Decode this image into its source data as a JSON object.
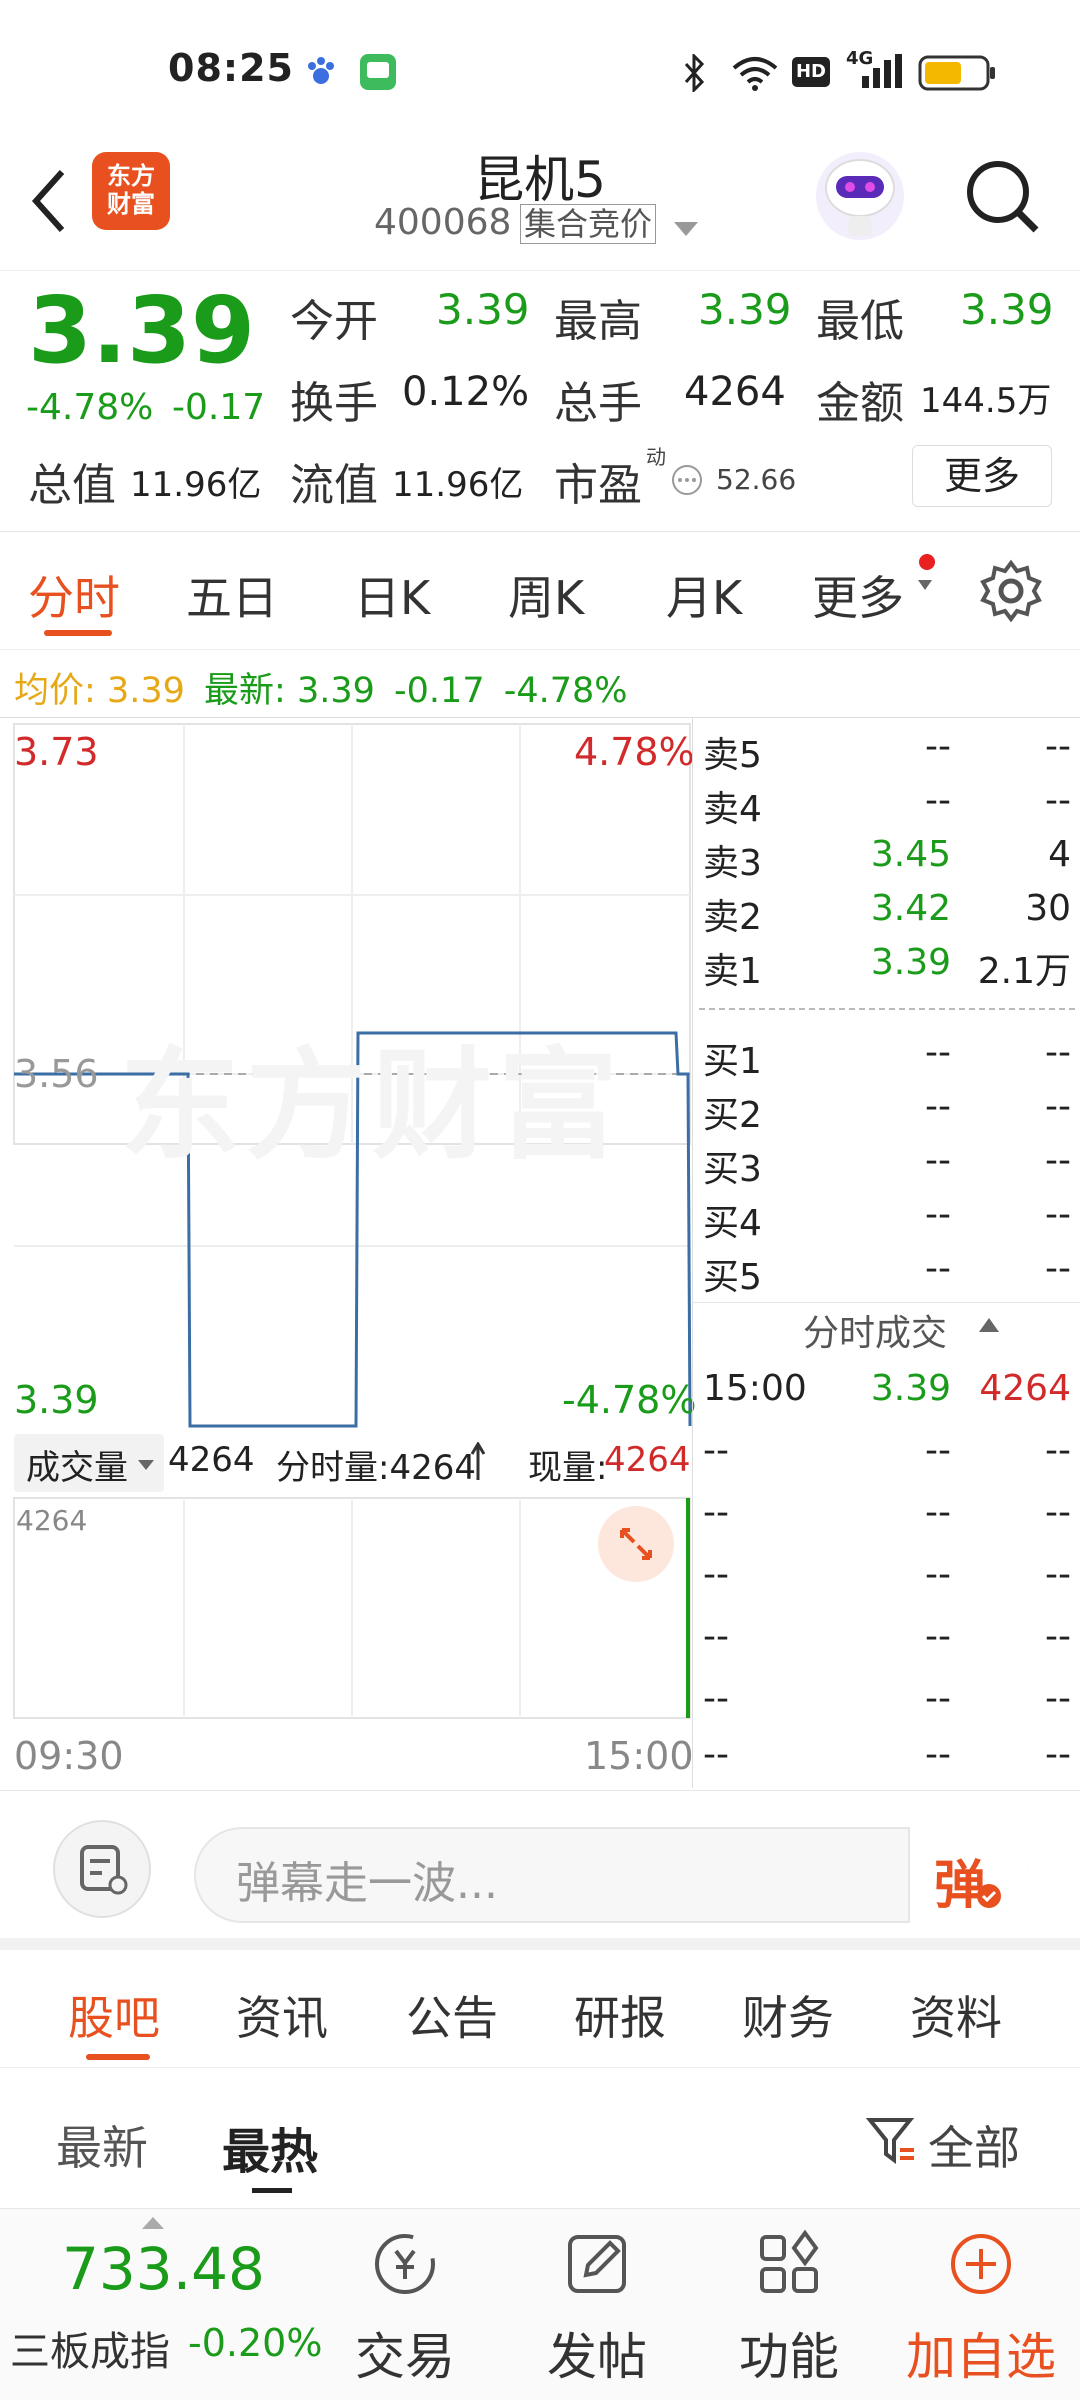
{
  "status_bar": {
    "time": "08:25",
    "network": "4G",
    "hd": "HD"
  },
  "header": {
    "title": "昆机5",
    "code": "400068",
    "auction_tag": "集合竞价",
    "logo_line1": "东方",
    "logo_line2": "财富"
  },
  "quote": {
    "price": "3.39",
    "change_pct": "-4.78%",
    "change": "-0.17",
    "fields": {
      "open_label": "今开",
      "open": "3.39",
      "high_label": "最高",
      "high": "3.39",
      "low_label": "最低",
      "low": "3.39",
      "turnover_label": "换手",
      "turnover": "0.12%",
      "volume_label": "总手",
      "volume": "4264",
      "amount_label": "金额",
      "amount": "144.5万",
      "mktcap_label": "总值",
      "mktcap": "11.96亿",
      "float_label": "流值",
      "float": "11.96亿",
      "pe_label": "市盈",
      "pe_sup": "动",
      "pe": "52.66"
    },
    "more_button": "更多"
  },
  "tabs": [
    "分时",
    "五日",
    "日K",
    "周K",
    "月K",
    "更多"
  ],
  "avg_line": {
    "avg_label": "均价:",
    "avg": "3.39",
    "latest_label": "最新:",
    "latest": "3.39",
    "chg": "-0.17",
    "pct": "-4.78%"
  },
  "chart": {
    "y_top": "3.73",
    "y_mid": "3.56",
    "y_bottom": "3.39",
    "pct_top": "4.78%",
    "pct_bottom": "-4.78%",
    "watermark": "东方财富",
    "vol_label": "成交量",
    "vol_total": "4264",
    "fenshi_label": "分时量:4264",
    "xian_label": "现量:",
    "xian_value": "4264",
    "vol_max": "4264",
    "time_start": "09:30",
    "time_end": "15:00",
    "colors": {
      "line": "#3a6ea5",
      "up": "#d22a2a",
      "down": "#1a9b1a"
    }
  },
  "orderbook": {
    "asks": [
      {
        "name": "卖5",
        "price": "--",
        "qty": "--"
      },
      {
        "name": "卖4",
        "price": "--",
        "qty": "--"
      },
      {
        "name": "卖3",
        "price": "3.45",
        "qty": "4"
      },
      {
        "name": "卖2",
        "price": "3.42",
        "qty": "30"
      },
      {
        "name": "卖1",
        "price": "3.39",
        "qty": "2.1万"
      }
    ],
    "bids": [
      {
        "name": "买1",
        "price": "--",
        "qty": "--"
      },
      {
        "name": "买2",
        "price": "--",
        "qty": "--"
      },
      {
        "name": "买3",
        "price": "--",
        "qty": "--"
      },
      {
        "name": "买4",
        "price": "--",
        "qty": "--"
      },
      {
        "name": "买5",
        "price": "--",
        "qty": "--"
      }
    ],
    "trades_title": "分时成交",
    "trades": [
      {
        "time": "15:00",
        "price": "3.39",
        "qty": "4264"
      },
      {
        "time": "--",
        "price": "--",
        "qty": "--"
      },
      {
        "time": "--",
        "price": "--",
        "qty": "--"
      },
      {
        "time": "--",
        "price": "--",
        "qty": "--"
      },
      {
        "time": "--",
        "price": "--",
        "qty": "--"
      },
      {
        "time": "--",
        "price": "--",
        "qty": "--"
      },
      {
        "time": "--",
        "price": "--",
        "qty": "--"
      }
    ]
  },
  "comment": {
    "placeholder": "弹幕走一波...",
    "danmu_button": "弹"
  },
  "sub_tabs": [
    "股吧",
    "资讯",
    "公告",
    "研报",
    "财务",
    "资料"
  ],
  "filter": {
    "latest": "最新",
    "hottest": "最热",
    "all": "全部"
  },
  "bottom_bar": {
    "index_value": "733.48",
    "index_name": "三板成指",
    "index_change": "-0.20%",
    "trade": "交易",
    "post": "发帖",
    "function": "功能",
    "add_watch": "加自选"
  }
}
